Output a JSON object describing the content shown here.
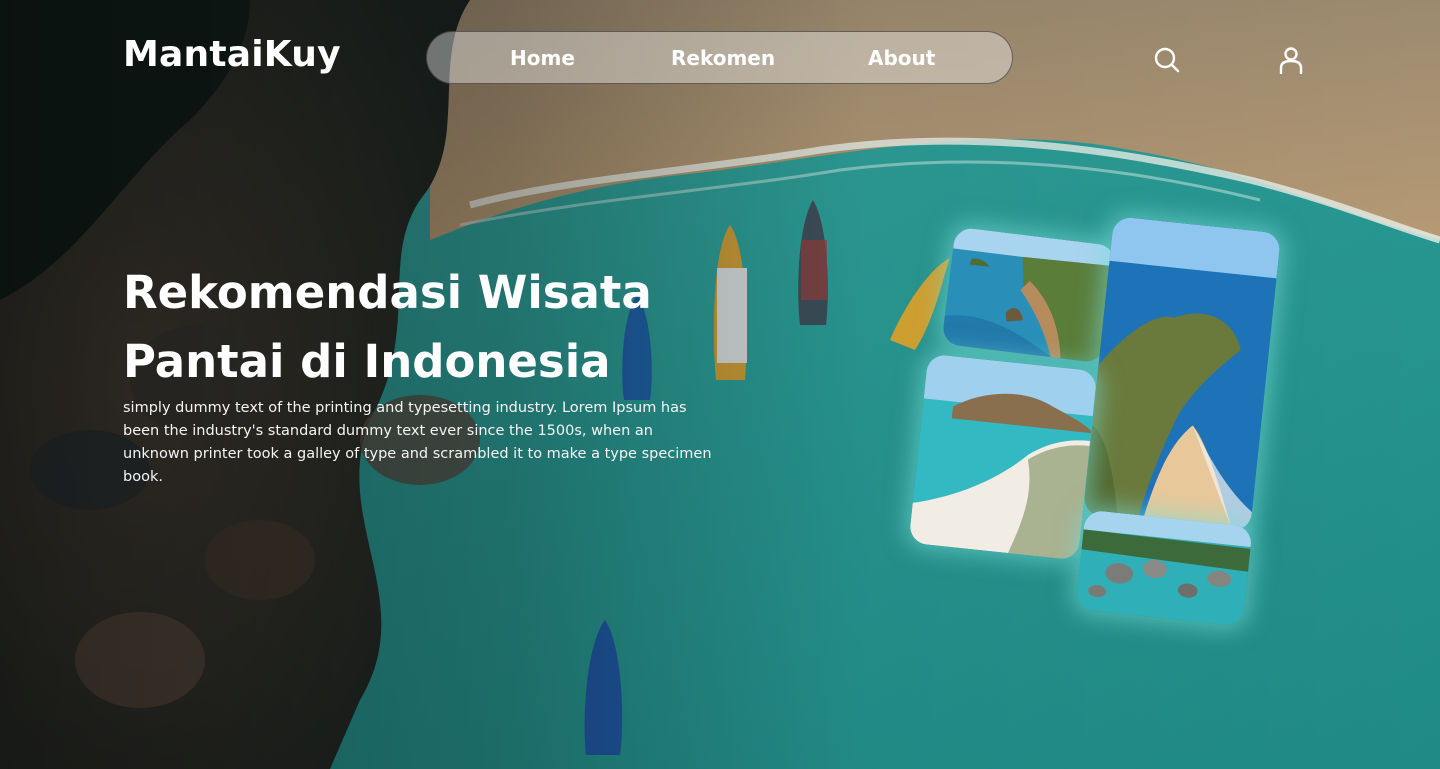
{
  "brand": {
    "name": "MantaiKuy"
  },
  "nav": {
    "items": [
      {
        "label": "Home"
      },
      {
        "label": "Rekomen"
      },
      {
        "label": "About"
      }
    ]
  },
  "header_icons": {
    "search": "search-icon",
    "user": "user-icon"
  },
  "hero": {
    "title_line1": "Rekomendasi Wisata",
    "title_line2": "Pantai di Indonesia",
    "description": "simply dummy text of the printing and typesetting industry. Lorem Ipsum has been the industry's standard dummy text ever since the 1500s, when an unknown printer took a galley of type and scrambled it to make a type specimen book."
  },
  "colors": {
    "sea": "#2f9c95",
    "sand": "#a8916f",
    "text": "#ffffff",
    "glow": "#78dcd7"
  }
}
